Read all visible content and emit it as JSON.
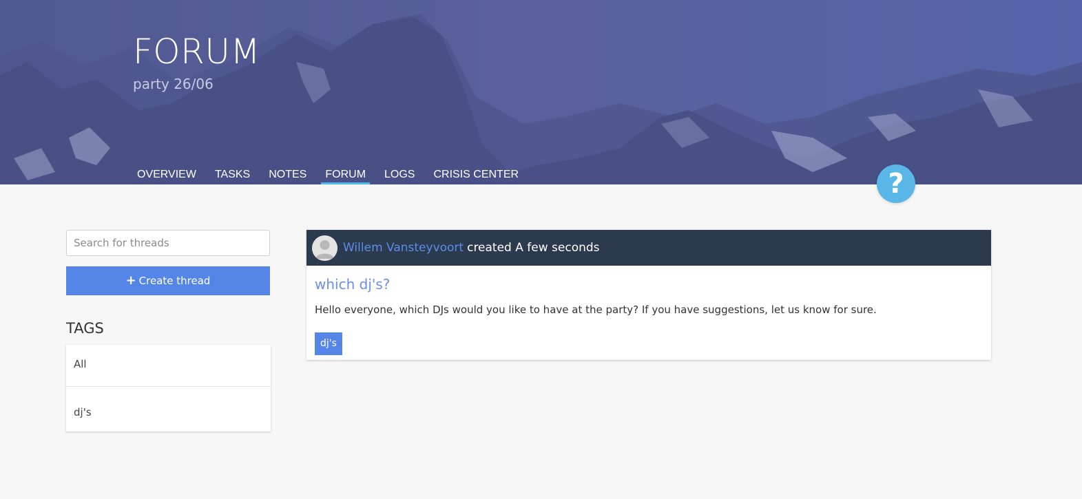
{
  "header": {
    "title": "FORUM",
    "subtitle": "party 26/06"
  },
  "nav": {
    "items": [
      {
        "label": "OVERVIEW"
      },
      {
        "label": "TASKS"
      },
      {
        "label": "NOTES"
      },
      {
        "label": "FORUM",
        "active": true
      },
      {
        "label": "LOGS"
      },
      {
        "label": "CRISIS CENTER"
      }
    ]
  },
  "help_button": {
    "label": "?"
  },
  "sidebar": {
    "search": {
      "placeholder": "Search for threads",
      "value": ""
    },
    "create_button": {
      "icon": "plus-icon",
      "label": "Create thread"
    },
    "tags_heading": "TAGS",
    "tags": [
      {
        "label": "All"
      },
      {
        "label": "dj's"
      }
    ]
  },
  "thread": {
    "author": "Willem Vansteyvoort",
    "created_text": "created A few seconds",
    "title": "which dj's?",
    "body": "Hello everyone, which DJs would you like to have at the party? If you have suggestions, let us know for sure.",
    "tag": "dj's"
  },
  "colors": {
    "accent": "#5685e8",
    "nav_active_underline": "#4fb8e8",
    "thread_header_bg": "#2c3a4f",
    "help_button": "#5bb6e8",
    "page_bg": "#f7f7f7"
  }
}
